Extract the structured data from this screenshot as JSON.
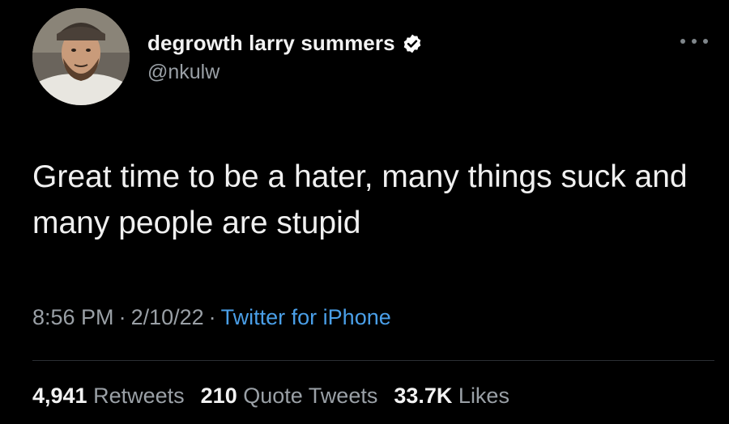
{
  "author": {
    "display_name": "degrowth larry summers",
    "handle": "@nkulw",
    "verified": true
  },
  "tweet": {
    "text": "Great time to be a hater, many things suck and many people are stupid",
    "time": "8:56 PM",
    "date": "2/10/22",
    "source": "Twitter for iPhone",
    "separator": "·"
  },
  "stats": {
    "retweets": {
      "count": "4,941",
      "label": "Retweets"
    },
    "quote_tweets": {
      "count": "210",
      "label": "Quote Tweets"
    },
    "likes": {
      "count": "33.7K",
      "label": "Likes"
    }
  },
  "colors": {
    "background": "#000000",
    "link": "#4a9fe8",
    "muted": "#9aa0a6",
    "verified_badge": "#ffffff"
  },
  "icons": {
    "verified": "verified-badge-icon",
    "more": "more-options-icon"
  }
}
